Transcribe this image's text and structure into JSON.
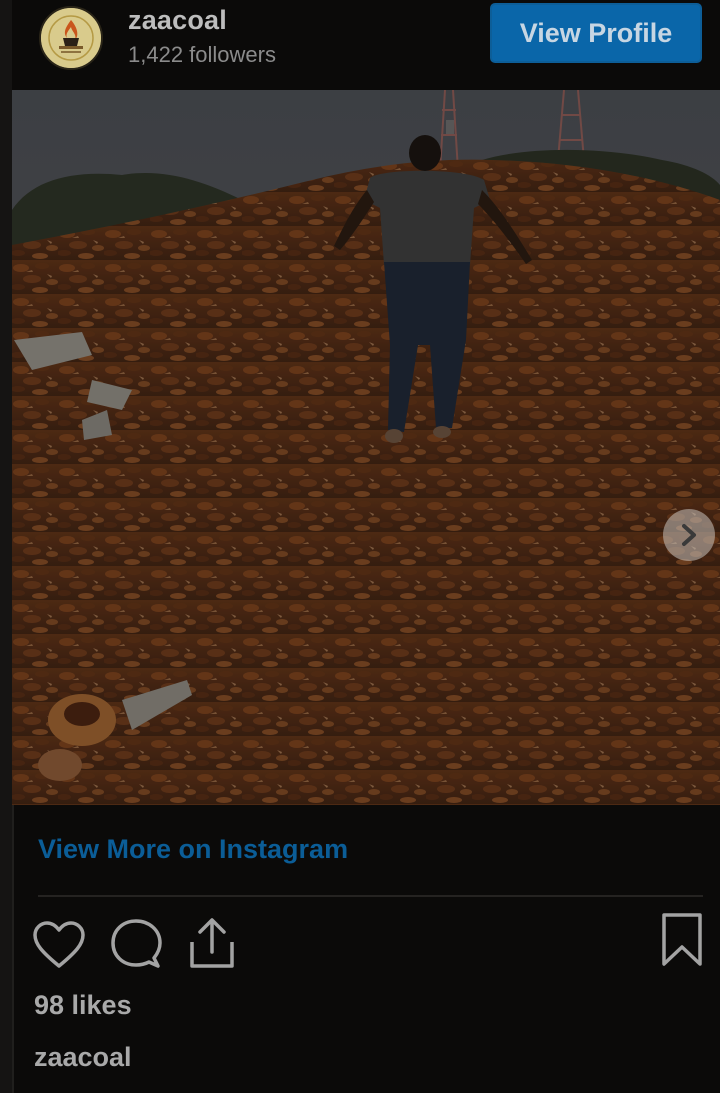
{
  "header": {
    "username": "zaacoal",
    "followers": "1,422 followers",
    "view_profile_label": "View Profile",
    "avatar_logo": "zaacoal-logo"
  },
  "post": {
    "carousel_next_icon": "chevron-right-icon",
    "view_more_label": "View More on Instagram",
    "likes": "98 likes",
    "caption_username": "zaacoal"
  },
  "actions": {
    "like_icon": "heart-icon",
    "comment_icon": "comment-icon",
    "share_icon": "share-icon",
    "save_icon": "bookmark-icon"
  },
  "colors": {
    "background": "#0b0a09",
    "button_blue": "#0a66a9",
    "link_blue": "#0b5d97",
    "text_muted": "#a9a9a9"
  }
}
